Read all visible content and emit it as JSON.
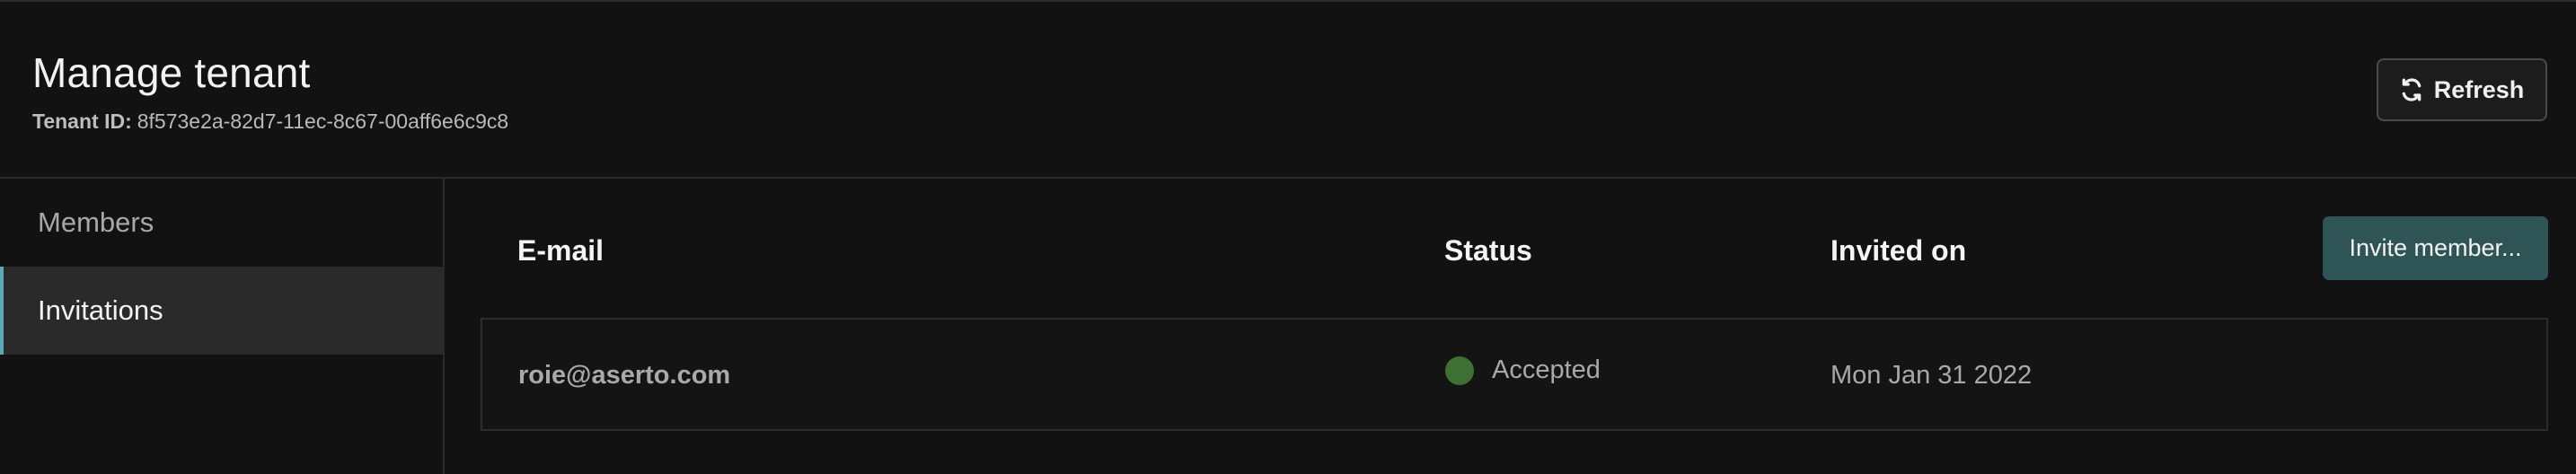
{
  "header": {
    "title": "Manage tenant",
    "tenant_label": "Tenant ID:",
    "tenant_id": "8f573e2a-82d7-11ec-8c67-00aff6e6c9c8",
    "refresh_label": "Refresh"
  },
  "sidebar": {
    "items": [
      {
        "label": "Members",
        "active": false
      },
      {
        "label": "Invitations",
        "active": true
      }
    ]
  },
  "table": {
    "columns": [
      "E-mail",
      "Status",
      "Invited on"
    ],
    "invite_button": "Invite member...",
    "rows": [
      {
        "email": "roie@aserto.com",
        "status": "Accepted",
        "invited_on": "Mon Jan 31 2022"
      }
    ]
  },
  "colors": {
    "accent": "#5aa9b5",
    "invite_button": "#2e5455",
    "status_accepted": "#3f7033"
  },
  "icons": {
    "refresh": "refresh-icon",
    "status": "status-dot-icon"
  }
}
